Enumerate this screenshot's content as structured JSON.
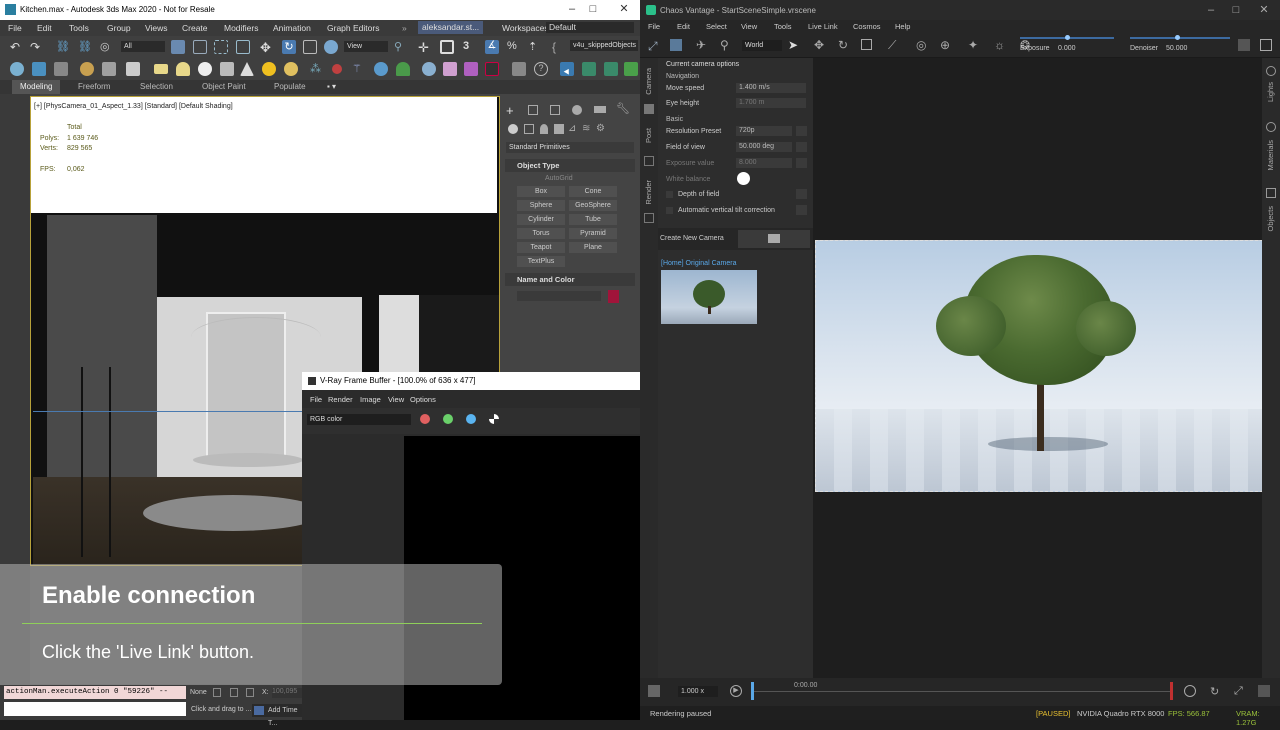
{
  "max": {
    "title": "Kitchen.max - Autodesk 3ds Max 2020 - Not for Resale",
    "menu": [
      "File",
      "Edit",
      "Tools",
      "Group",
      "Views",
      "Create",
      "Modifiers",
      "Animation",
      "Graph Editors"
    ],
    "user": "aleksandar.st...",
    "workspaces_label": "Workspaces:",
    "workspaces_value": "Default",
    "selection_filter": "All",
    "view_dropdown": "View",
    "named_sel": "v4u_skippedObjects",
    "ribbon_tabs": [
      "Modeling",
      "Freeform",
      "Selection",
      "Object Paint",
      "Populate"
    ],
    "viewport_label": "[+] [PhysCamera_01_Aspect_1.33] [Standard] [Default Shading]",
    "stats": {
      "total_label": "Total",
      "polys_label": "Polys:",
      "polys_value": "1 639 746",
      "verts_label": "Verts:",
      "verts_value": "829 565",
      "fps_label": "FPS:",
      "fps_value": "0,062"
    },
    "cmd_panel": {
      "dropdown": "Standard Primitives",
      "object_type": "Object Type",
      "autogrid": "AutoGrid",
      "buttons": [
        "Box",
        "Cone",
        "Sphere",
        "GeoSphere",
        "Cylinder",
        "Tube",
        "Torus",
        "Pyramid",
        "Teapot",
        "Plane",
        "TextPlus"
      ],
      "name_and_color": "Name and Color",
      "color_swatch": "#a0143a"
    },
    "script_line": "actionMan.executeAction 0 \"59226\"  --",
    "status_none": "None",
    "status_hint": "Click and drag to ...",
    "add_time": "Add Time T...",
    "x_label": "X:",
    "x_value": "100,095"
  },
  "vfb": {
    "title": "V-Ray Frame Buffer - [100.0% of 636 x 477]",
    "menu": [
      "File",
      "Render",
      "Image",
      "View",
      "Options"
    ],
    "channel": "RGB color",
    "dots": [
      "#e06060",
      "#6ad06a",
      "#5ab4f0"
    ]
  },
  "caption": {
    "title": "Enable connection",
    "subtitle": "Click the 'Live Link' button."
  },
  "vantage": {
    "title": "Chaos Vantage - StartSceneSimple.vrscene",
    "menu": [
      "File",
      "Edit",
      "Select",
      "View",
      "Tools",
      "Live Link",
      "Cosmos",
      "Help"
    ],
    "space": "World",
    "exposure_label": "Exposure",
    "exposure_value": "0.000",
    "denoiser_label": "Denoiser",
    "denoiser_value": "50.000",
    "left_tabs": [
      "Camera",
      "Post",
      "Render"
    ],
    "right_tabs": [
      "Lights",
      "Materials",
      "Objects"
    ],
    "panel": {
      "section": "Current camera options",
      "navigation": "Navigation",
      "move_speed_label": "Move speed",
      "move_speed_value": "1.400 m/s",
      "eye_height_label": "Eye height",
      "eye_height_value": "1.700 m",
      "basic": "Basic",
      "resolution_label": "Resolution Preset",
      "resolution_value": "720p",
      "fov_label": "Field of view",
      "fov_value": "50.000 deg",
      "exposure_label": "Exposure value",
      "exposure_value": "8.000",
      "wb_label": "White balance",
      "dof_label": "Depth of field",
      "avt_label": "Automatic vertical tilt correction",
      "create_camera": "Create New Camera",
      "camera_name": "[Home] Original Camera"
    },
    "timeline_speed": "1.000 x",
    "timeline_time": "0:00.00",
    "status_left": "Rendering paused",
    "status_paused": "[PAUSED]",
    "gpu": "NVIDIA Quadro RTX 8000",
    "fps": "FPS: 566.87",
    "vram": "VRAM: 1.27G"
  }
}
